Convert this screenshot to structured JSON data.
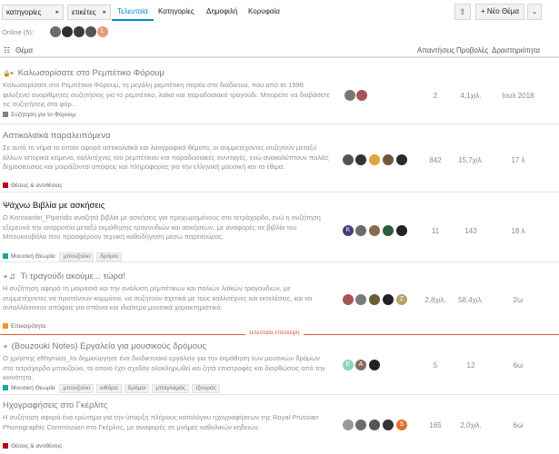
{
  "nav": {
    "categories_dd": "κατηγορίες",
    "tags_dd": "ετικέτες",
    "tabs": [
      "Τελευταία",
      "Κατηγορίες",
      "Δημοφιλή",
      "Κορυφαία"
    ],
    "new_topic": "Νέο Θέμα"
  },
  "online": {
    "label": "Online (5):",
    "avatars": [
      {
        "letter": "",
        "color": "#6b6b6b"
      },
      {
        "letter": "",
        "color": "#2f2f2f"
      },
      {
        "letter": "",
        "color": "#3b3b3b"
      },
      {
        "letter": "",
        "color": "#555555"
      },
      {
        "letter": "L",
        "color": "#e89a7a"
      }
    ]
  },
  "header": {
    "topic": "Θέμα",
    "replies": "Απαντήσεις",
    "views": "Προβολές",
    "activity": "Δραστηριότητα"
  },
  "topics": [
    {
      "title": "Καλωσορίσατε στο Ρεμπέτικο Φόρουμ",
      "excerpt": "Καλωσορίσατε στο Ρεμπέτικο Φόρουμ, τη μεγάλη ρεμπέτικη παρέα στο διαδίκτυο, που από το 1996 φιλοξενεί αναρίθμητες συζητήσεις για το ρεμπέτικο, λαϊκό και παραδοσιακό τραγούδι. Μπορείτε να διαβάσετε τις συζητήσεις στο φόρ…",
      "category": "Συζήτηση για το Φόρουμ",
      "cat_color": "#808281",
      "tags": [],
      "replies": "2",
      "views": "4,1χιλ.",
      "activity": "Ιουλ 2018"
    },
    {
      "title": "Αστικολαϊκά παραλειπόμενα",
      "excerpt": "Σε αυτό το νήμα το οποίο αφορά αστικολαϊκά και λαογραφικά θέματα, οι συμμετέχοντες συζητούν μεταξύ άλλων ιστορικά κείμενα, καλλιτέχνες του ρεμπέτικου και παραδοσιακές συνιταγές, ενώ ανακαλύπτουν παλιές δημοσιεύσεις και μοιράζονται απόψεις και πληροφορίες για την ελληνική μουσική και τα έθιμα.",
      "category": "Θέσεις & αντιθέσεις",
      "cat_color": "#b3001b",
      "tags": [],
      "replies": "842",
      "views": "15,7χιλ.",
      "activity": "17 λ"
    },
    {
      "title": "Ψάχνω Βιβλία με ασκήσεις",
      "excerpt": "Ο Konstantin_Piperidis αναζητά βιβλία με ασκήσεις για προχωρημένους στο τετράχορδο, ενώ η συζήτηση εξερευνά την ισορροπία μεταξύ εκμάθησης τραγουδιών και ασκήσεων, με αναφορές σε βιβλία του Μπουκουβάλα που προσφέρουν τεχνική καθοδήγηση μέσω παρτιτούρας.",
      "category": "Μουσική Θεωρία",
      "cat_color": "#12a89d",
      "tags": [
        "μπουζούκι",
        "δρόμοι"
      ],
      "replies": "11",
      "views": "143",
      "activity": "18 λ"
    },
    {
      "title": "Τι τραγούδι ακούμε... τώρα!",
      "excerpt": "Η συζήτηση αφορά τη μοιρασιά και την ανάλυση ρεμπέτικων και παλιών λαϊκών τραγουδιών, με συμμετέχοντες να προτείνουν κομμάτια, να συζητούν σχετικά με τους καλλιτέχνες και εκτελέσεις, και να ανταλλάσσουν απόψεις για σπάνια και ιδιαίτερα μουσικά χαρακτηριστικά.",
      "category": "Επικαιρότητα",
      "cat_color": "#f7941d",
      "tags": [],
      "replies": "2,8χιλ.",
      "views": "58,4χιλ.",
      "activity": "2ω"
    },
    {
      "title": "(Bouzouki Notes) Εργαλείο για μουσικούς δρόμους",
      "excerpt": "Ο χρήστης efthymios_ks δημιούργησε ένα διαδικτυακό εργαλείο για την εκμάθηση των μουσικών δρόμων στο τετράχορδο μπουζούκι, το οποίο έχει σχεδόν ολοκληρωθεί και ζητά επιστροφές και διορθώσεις από την κοινότητα.",
      "category": "Μουσική Θεωρία",
      "cat_color": "#12a89d",
      "tags": [
        "μπουζούκι",
        "κιθάρα",
        "δρόμοι",
        "μπαγλαμάς",
        "τζουράς"
      ],
      "replies": "5",
      "views": "12",
      "activity": "6ω"
    },
    {
      "title": "Ηχογραφήσεις στο Γκέρλιτς",
      "excerpt": "Η συζήτηση αφορά ένα ερώτημα για την ύπαρξη πλήρους καταλόγου ηχογραφήσεων της Royal Prussian Phonographic Commission στο Γκέρλιτς, με αναφορές σε μνήμες καθολικών κηδειών.",
      "category": "Θέσεις & αντιθέσεις",
      "cat_color": "#b3001b",
      "tags": [],
      "replies": "165",
      "views": "2,0χιλ.",
      "activity": "6ω"
    }
  ],
  "last_visit": "τελευταία επίσκεψη",
  "colors": {
    "accent": "#0088cc",
    "hot": "#cc8a17",
    "last_visit": "#e45735"
  }
}
